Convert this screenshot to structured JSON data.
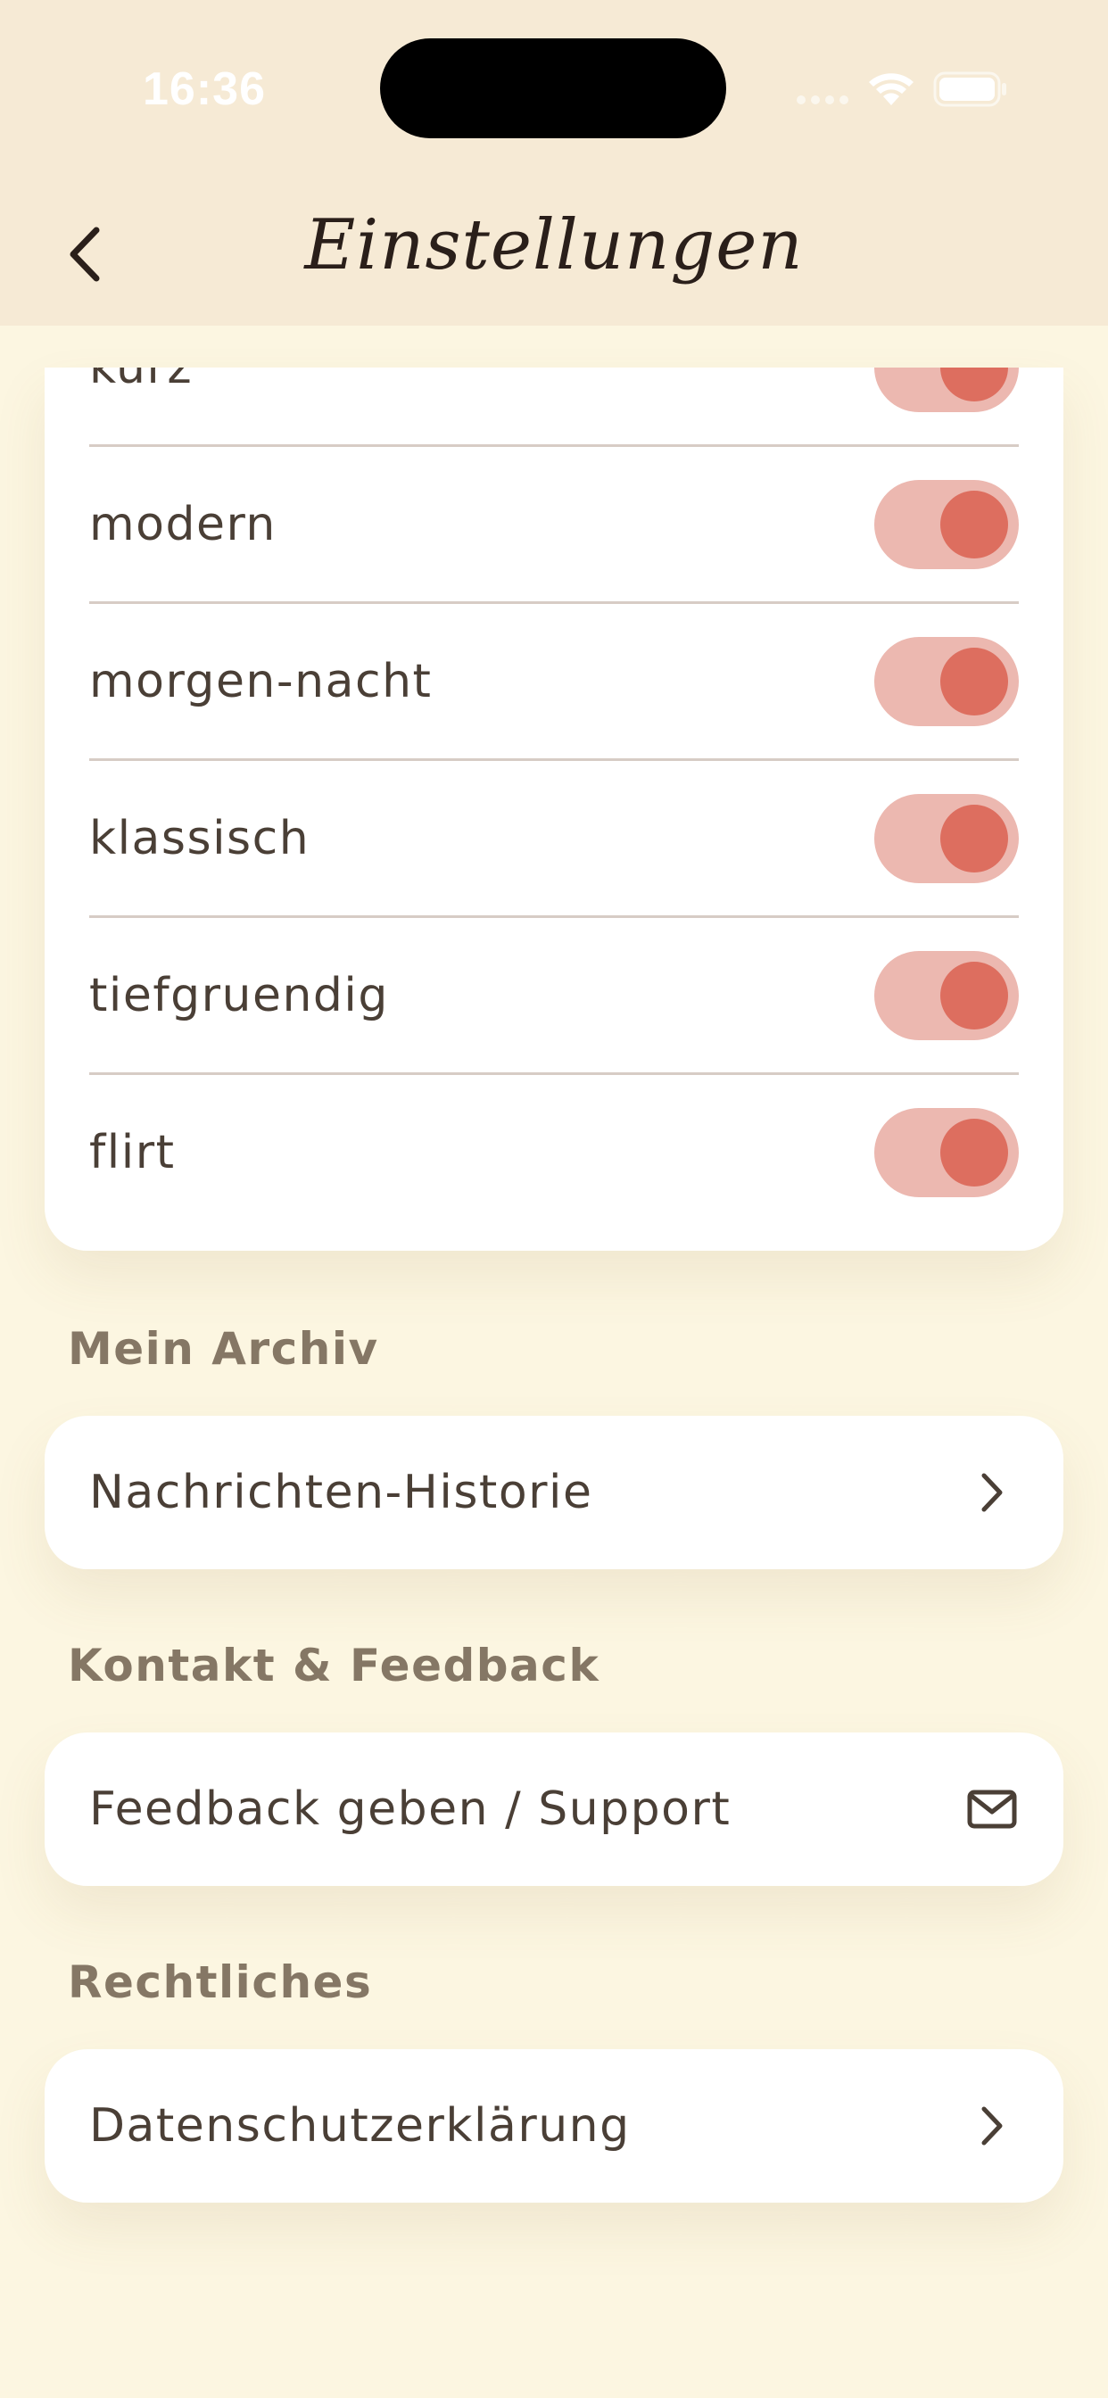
{
  "status_bar": {
    "time": "16:36"
  },
  "nav": {
    "title": "Einstellungen"
  },
  "toggles": [
    {
      "label": "kurz",
      "on": true
    },
    {
      "label": "modern",
      "on": true
    },
    {
      "label": "morgen-nacht",
      "on": true
    },
    {
      "label": "klassisch",
      "on": true
    },
    {
      "label": "tiefgruendig",
      "on": true
    },
    {
      "label": "flirt",
      "on": true
    }
  ],
  "sections": {
    "archive": {
      "header": "Mein Archiv",
      "item_label": "Nachrichten-Historie",
      "item_icon": "chevron-right-icon"
    },
    "contact": {
      "header": "Kontakt & Feedback",
      "item_label": "Feedback geben / Support",
      "item_icon": "mail-icon"
    },
    "legal": {
      "header": "Rechtliches",
      "item_label": "Datenschutzerklärung",
      "item_icon": "chevron-right-icon"
    }
  },
  "colors": {
    "background": "#FCF6E1",
    "header_bg": "#F6EAD5",
    "toggle_track": "#ECB8B0",
    "toggle_knob": "#DD6E5F",
    "section_header": "#857765"
  }
}
